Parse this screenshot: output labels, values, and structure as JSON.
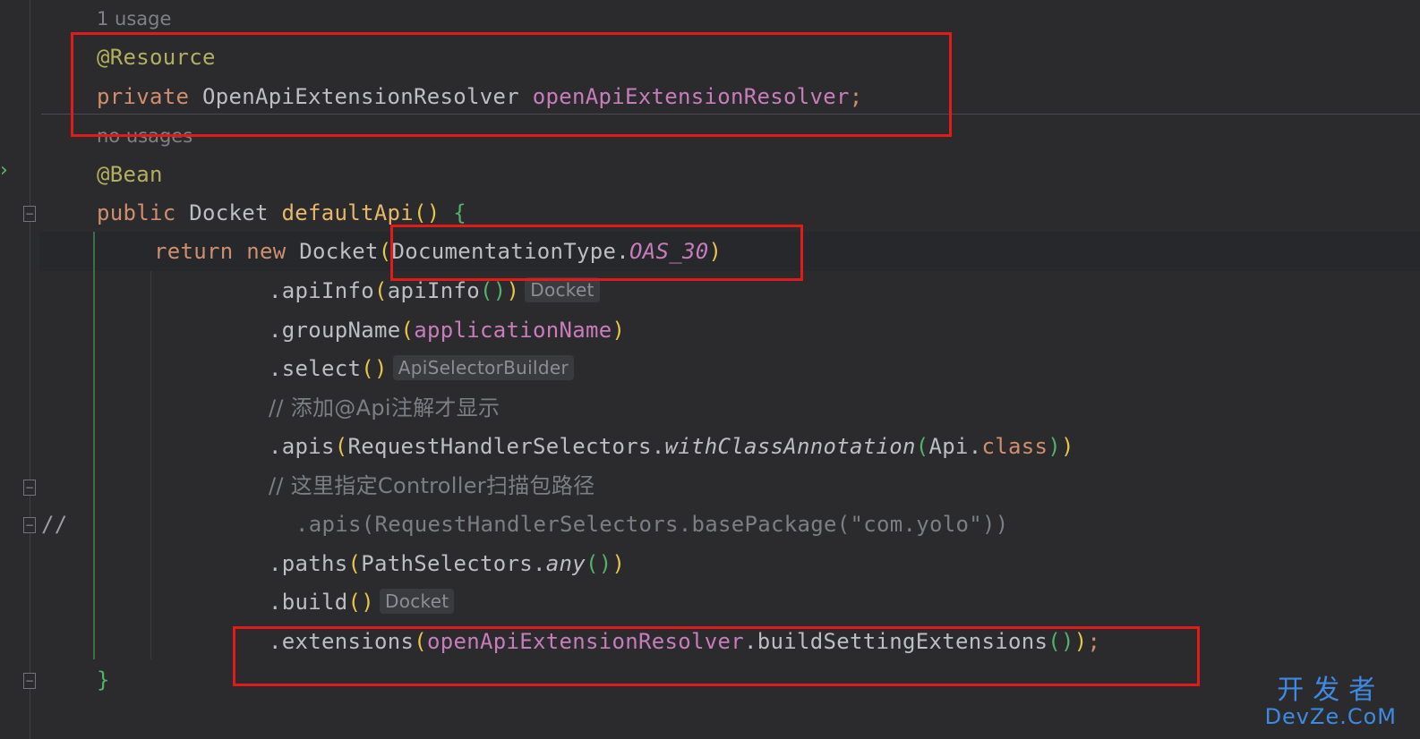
{
  "hints": {
    "usage_resource": "1 usage",
    "usage_bean": "no usages"
  },
  "code": {
    "line1_annotation": "@Resource",
    "line2_kw": "private",
    "line2_type": "OpenApiExtensionResolver",
    "line2_field": "openApiExtensionResolver",
    "line2_semi": ";",
    "line3_annotation": "@Bean",
    "line4_kw": "public",
    "line4_type": "Docket",
    "line4_method": "defaultApi",
    "line5_kw1": "return",
    "line5_kw2": "new",
    "line5_type": "Docket",
    "line5_arg_class": "DocumentationType.",
    "line5_arg_const": "OAS_30",
    "line6_method": ".apiInfo",
    "line6_arg": "apiInfo",
    "line6_inlay": "Docket",
    "line7_method": ".groupName",
    "line7_arg": "applicationName",
    "line8_method": ".select",
    "line8_inlay": "ApiSelectorBuilder",
    "line9_comment": "// 添加@Api注解才显示",
    "line10_method": ".apis",
    "line10_arg_class": "RequestHandlerSelectors.",
    "line10_arg_method": "withClassAnnotation",
    "line10_arg_inner": "Api.",
    "line10_arg_kw": "class",
    "line11_comment": "// 这里指定Controller扫描包路径",
    "line12_prefix": "//",
    "line12_code": ".apis(RequestHandlerSelectors.basePackage(\"com.yolo\"))",
    "line13_method": ".paths",
    "line13_arg_class": "PathSelectors.",
    "line13_arg_method": "any",
    "line14_method": ".build",
    "line14_inlay": "Docket",
    "line15_method": ".extensions",
    "line15_arg_field": "openApiExtensionResolver",
    "line15_arg_method": ".buildSettingExtensions",
    "line15_semi": ";",
    "line16_brace": "}"
  },
  "watermark": {
    "top": "开发者",
    "bottom": "DevZe.CoM"
  },
  "colors": {
    "background": "#2b2b2d",
    "keyword": "#cf8e6d",
    "annotation": "#b3ae60",
    "field": "#c77dbb",
    "highlight_box": "#e11a1a"
  }
}
